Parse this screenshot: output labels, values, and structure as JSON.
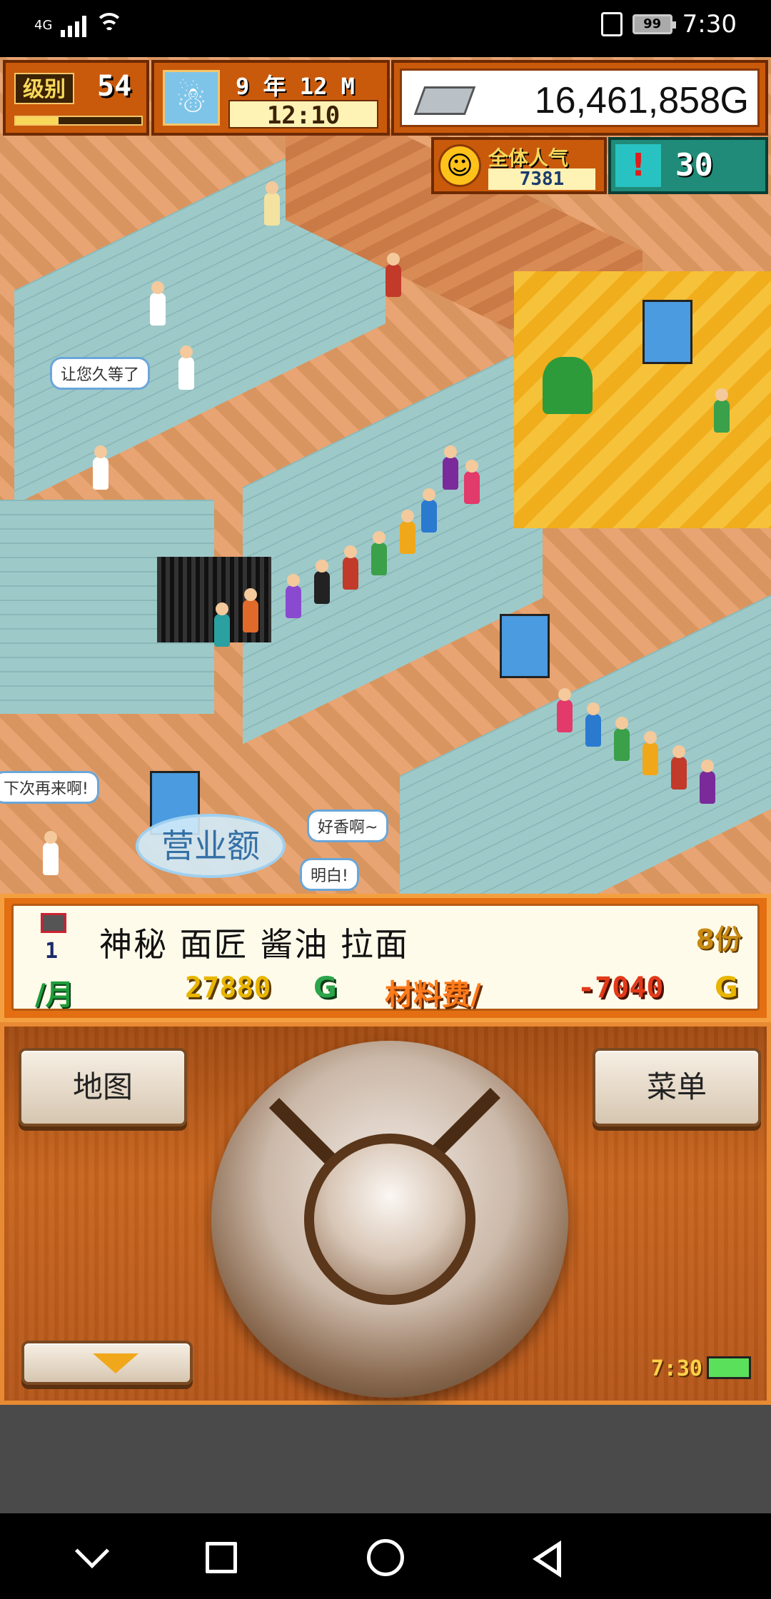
{
  "status_bar": {
    "network": "4G",
    "battery": "99",
    "time": "7:30"
  },
  "hud": {
    "level_label": "级别",
    "level": "54",
    "level_progress": 0.34,
    "date_year": "9 年 12 M",
    "date_clock": "12:10",
    "money": "16,461,858",
    "money_unit": "G",
    "popularity_label": "全体人气",
    "popularity": "7381",
    "alert_count": "30"
  },
  "scene": {
    "bubbles": [
      "让您久等了",
      "下次再来啊!",
      "好香啊~",
      "明白!"
    ],
    "sales_bubble": "营业额"
  },
  "info_panel": {
    "rank": "1",
    "dish_name": "神秘 面匠 酱油 拉面",
    "servings": "8份",
    "month_label": "/月",
    "price": "27880",
    "price_unit": "G",
    "cost_label": "材料费/",
    "cost": "-7040",
    "cost_unit": "G"
  },
  "controls": {
    "map_label": "地图",
    "menu_label": "菜单",
    "clock": "7:30"
  },
  "colors": {
    "panel_orange": "#e36f12",
    "wood": "#c8651e",
    "accent_yellow": "#f7d85b"
  }
}
